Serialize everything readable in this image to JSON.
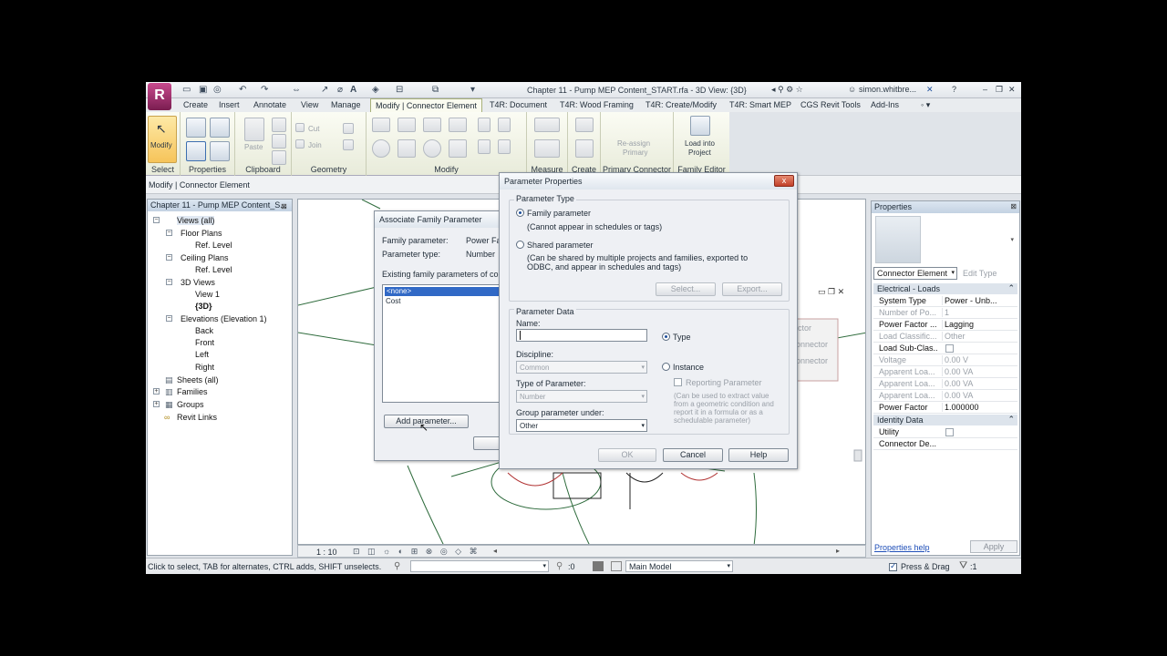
{
  "window": {
    "title": "Chapter 11 - Pump MEP Content_START.rfa - 3D View: {3D}",
    "user": "simon.whitbre...",
    "app_letter": "R"
  },
  "tabs": [
    "Create",
    "Insert",
    "Annotate",
    "View",
    "Manage",
    "Modify | Connector Element",
    "T4R: Document",
    "T4R: Wood Framing",
    "T4R: Create/Modify",
    "T4R: Smart MEP",
    "CGS Revit Tools",
    "Add-Ins"
  ],
  "ribbon": {
    "panels": {
      "select": "Select",
      "properties": "Properties",
      "clipboard": "Clipboard",
      "geometry": "Geometry",
      "modify": "Modify",
      "measure": "Measure",
      "create": "Create",
      "primary_connector": "Primary Connector",
      "family_editor": "Family Editor"
    },
    "modify_label": "Modify",
    "paste_label": "Paste",
    "cut_label": "Cut",
    "join_label": "Join",
    "reassign": "Re-assign",
    "reassign2": "Primary",
    "load_into": "Load into",
    "load_into2": "Project"
  },
  "context_label": "Modify | Connector Element",
  "browser": {
    "title": "Chapter 11 - Pump MEP Content_S...",
    "items": {
      "views": "Views (all)",
      "floor_plans": "Floor Plans",
      "ref_level_1": "Ref. Level",
      "ceiling_plans": "Ceiling Plans",
      "ref_level_2": "Ref. Level",
      "views_3d": "3D Views",
      "view_1": "View 1",
      "view_3d": "{3D}",
      "elevations": "Elevations (Elevation 1)",
      "back": "Back",
      "front": "Front",
      "left": "Left",
      "right": "Right",
      "sheets": "Sheets (all)",
      "families": "Families",
      "groups": "Groups",
      "revit_links": "Revit Links"
    }
  },
  "view": {
    "scale": "1 : 10",
    "side_labels": [
      "ctor",
      "onnector",
      "onnector"
    ]
  },
  "assoc_dialog": {
    "title": "Associate Family Parameter",
    "family_param_label": "Family parameter:",
    "family_param_value": "Power Fac",
    "param_type_label": "Parameter type:",
    "param_type_value": "Number",
    "existing_label": "Existing family parameters of compa",
    "list": [
      "<none>",
      "Cost"
    ],
    "add_button": "Add parameter..."
  },
  "param_dialog": {
    "title": "Parameter Properties",
    "close": "x",
    "type_group": "Parameter Type",
    "family_param": "Family parameter",
    "family_note": "(Cannot appear in schedules or tags)",
    "shared_param": "Shared parameter",
    "shared_note": "(Can be shared by multiple projects and families, exported to ODBC, and appear in schedules and tags)",
    "select_btn": "Select...",
    "export_btn": "Export...",
    "data_group": "Parameter Data",
    "name_label": "Name:",
    "name_value": "",
    "discipline_label": "Discipline:",
    "discipline_value": "Common",
    "type_of_param_label": "Type of Parameter:",
    "type_of_param_value": "Number",
    "group_under_label": "Group parameter under:",
    "group_under_value": "Other",
    "type_radio": "Type",
    "instance_radio": "Instance",
    "reporting": "Reporting Parameter",
    "reporting_note": "(Can be used to extract value from a geometric condition and report it in a formula or as a schedulable parameter)",
    "ok": "OK",
    "cancel": "Cancel",
    "help": "Help"
  },
  "properties": {
    "title": "Properties",
    "type_value": "Connector Element",
    "edit_type": "Edit Type",
    "group1": "Electrical - Loads",
    "rows1": [
      {
        "k": "System Type",
        "v": "Power - Unb..."
      },
      {
        "k": "Number of Po...",
        "v": "1"
      },
      {
        "k": "Power Factor ...",
        "v": "Lagging"
      },
      {
        "k": "Load Classific...",
        "v": "Other"
      },
      {
        "k": "Load Sub-Clas...",
        "v": ""
      },
      {
        "k": "Voltage",
        "v": "0.00 V"
      },
      {
        "k": "Apparent Loa...",
        "v": "0.00 VA"
      },
      {
        "k": "Apparent Loa...",
        "v": "0.00 VA"
      },
      {
        "k": "Apparent Loa...",
        "v": "0.00 VA"
      },
      {
        "k": "Power Factor",
        "v": "1.000000"
      }
    ],
    "group2": "Identity Data",
    "rows2": [
      {
        "k": "Utility",
        "v": ""
      },
      {
        "k": "Connector De...",
        "v": ""
      }
    ],
    "help": "Properties help",
    "apply": "Apply"
  },
  "status": {
    "text": "Click to select, TAB for alternates, CTRL adds, SHIFT unselects.",
    "zero": ":0",
    "model": "Main Model",
    "press_drag": "Press & Drag",
    "filter": ":1"
  }
}
